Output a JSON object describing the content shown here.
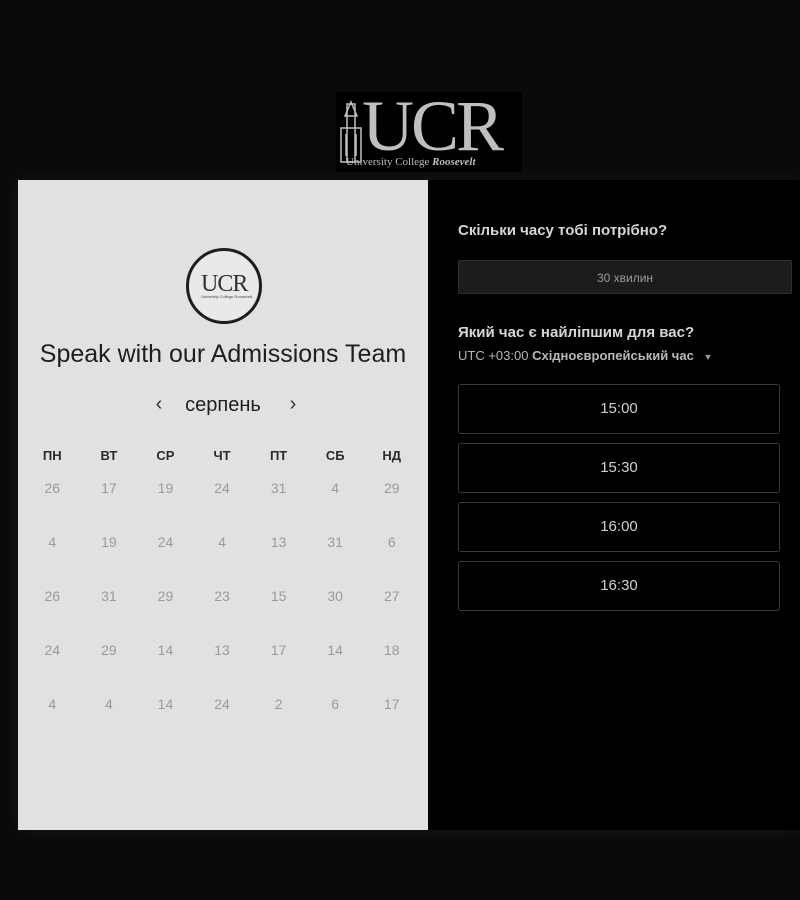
{
  "header": {
    "logo_mark": "UCR",
    "logo_sub_prefix": "University College ",
    "logo_sub_emph": "Roosevelt"
  },
  "left": {
    "circle_logo_mark": "UCR",
    "circle_logo_sub": "University College Roosevelt",
    "title": "Speak with our Admissions Team",
    "month": "серпень",
    "weekdays": [
      "ПН",
      "ВТ",
      "СР",
      "ЧТ",
      "ПТ",
      "СБ",
      "НД"
    ],
    "days": [
      [
        "26",
        "17",
        "19",
        "24",
        "31",
        "4",
        "29"
      ],
      [
        "4",
        "19",
        "24",
        "4",
        "13",
        "31",
        "6"
      ],
      [
        "26",
        "31",
        "29",
        "23",
        "15",
        "30",
        "27"
      ],
      [
        "24",
        "29",
        "14",
        "13",
        "17",
        "14",
        "18"
      ],
      [
        "4",
        "4",
        "14",
        "24",
        "2",
        "6",
        "17"
      ]
    ]
  },
  "right": {
    "duration_question": "Скільки часу тобі потрібно?",
    "duration_value": "30 хвилин",
    "time_question": "Який час є найліпшим для вас?",
    "tz_offset": "UTC +03:00",
    "tz_name": "Східноєвропейський час",
    "slots": [
      "15:00",
      "15:30",
      "16:00",
      "16:30"
    ]
  },
  "icons": {
    "prev": "chevron-left-icon",
    "next": "chevron-right-icon",
    "caret": "caret-down-icon"
  }
}
